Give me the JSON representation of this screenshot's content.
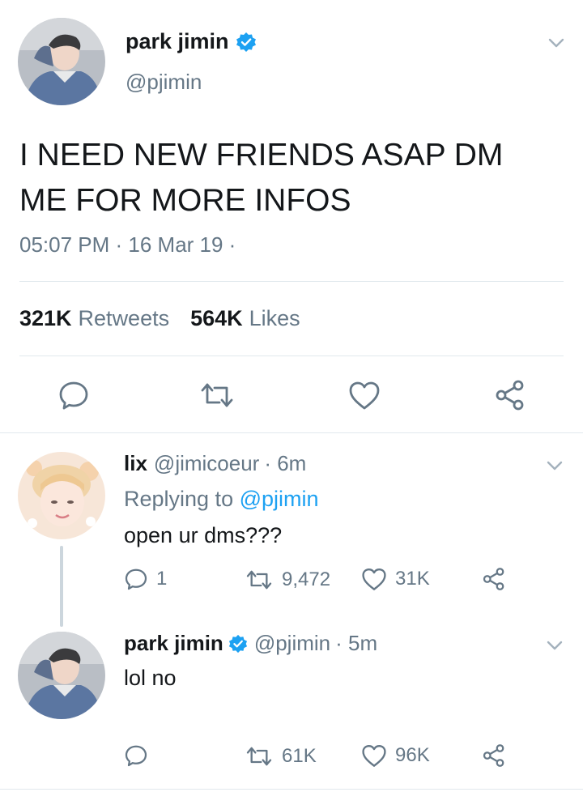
{
  "main_tweet": {
    "display_name": "park jimin",
    "handle": "@pjimin",
    "verified": true,
    "text_line1": "I NEED NEW FRIENDS ASAP DM",
    "text_line2": "ME FOR MORE INFOS",
    "timestamp": "05:07 PM · 16 Mar 19 ·",
    "stats": {
      "retweets_count": "321K",
      "retweets_label": "Retweets",
      "likes_count": "564K",
      "likes_label": "Likes"
    },
    "icons": [
      "reply-icon",
      "retweet-icon",
      "like-icon",
      "share-icon"
    ]
  },
  "replies": [
    {
      "display_name": "lix",
      "handle": "@jimicoeur",
      "time": "· 6m",
      "replying_prefix": "Replying to",
      "replying_to": "@pjimin",
      "text": "open ur dms???",
      "reply_count": "1",
      "retweet_count": "9,472",
      "like_count": "31K"
    },
    {
      "display_name": "park jimin",
      "verified": true,
      "handle": "@pjimin",
      "time": "· 5m",
      "text": "lol no",
      "reply_count": "",
      "retweet_count": "61K",
      "like_count": "96K"
    }
  ],
  "colors": {
    "accent": "#1da1f2",
    "secondary_text": "#657786",
    "divider": "#e1e8ed",
    "text": "#14171a"
  }
}
